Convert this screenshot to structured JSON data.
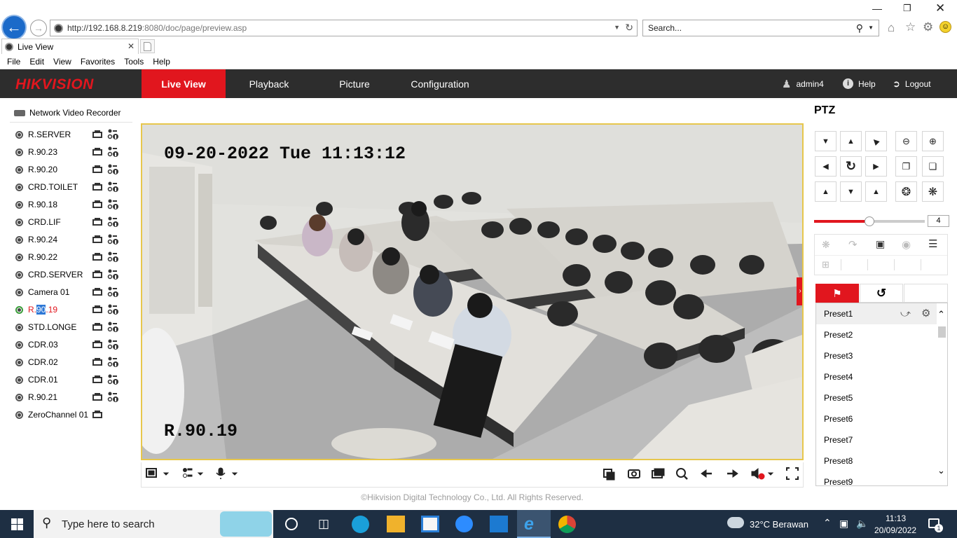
{
  "browser": {
    "url_host": "http://192.168.8.219",
    "url_rest": ":8080/doc/page/preview.asp",
    "search_placeholder": "Search...",
    "tab_title": "Live View",
    "menu": [
      "File",
      "Edit",
      "View",
      "Favorites",
      "Tools",
      "Help"
    ]
  },
  "header": {
    "logo": "HIKVISION",
    "nav": [
      "Live View",
      "Playback",
      "Picture",
      "Configuration"
    ],
    "user": "admin4",
    "help": "Help",
    "logout": "Logout"
  },
  "tree": {
    "root": "Network Video Recorder",
    "cameras": [
      "R.SERVER",
      "R.90.23",
      "R.90.20",
      "CRD.TOILET",
      "R.90.18",
      "CRD.LIF",
      "R.90.24",
      "R.90.22",
      "CRD.SERVER",
      "Camera 01",
      "R.90.19",
      "STD.LONGE",
      "CDR.03",
      "CDR.02",
      "CDR.01",
      "R.90.21",
      "ZeroChannel 01"
    ],
    "active_camera": "R.90.19",
    "active_prefix": "R.",
    "active_selected": "90",
    "active_suffix": ".19"
  },
  "video": {
    "osd_time": "09-20-2022 Tue 11:13:12",
    "osd_name": "R.90.19"
  },
  "footer": {
    "copyright": "©Hikvision Digital Technology Co., Ltd. All Rights Reserved."
  },
  "ptz": {
    "title": "PTZ",
    "speed": "4",
    "speed_fraction": 0.5,
    "presets": [
      "Preset1",
      "Preset2",
      "Preset3",
      "Preset4",
      "Preset5",
      "Preset6",
      "Preset7",
      "Preset8",
      "Preset9"
    ]
  },
  "taskbar": {
    "search_placeholder": "Type here to search",
    "weather": "32°C  Berawan",
    "time": "11:13",
    "date": "20/09/2022",
    "notif_count": "1"
  },
  "colors": {
    "accent": "#e1161e",
    "header_bg": "#2d2d2d",
    "video_border": "#e7c74c",
    "taskbar_bg": "#1e2f43"
  }
}
